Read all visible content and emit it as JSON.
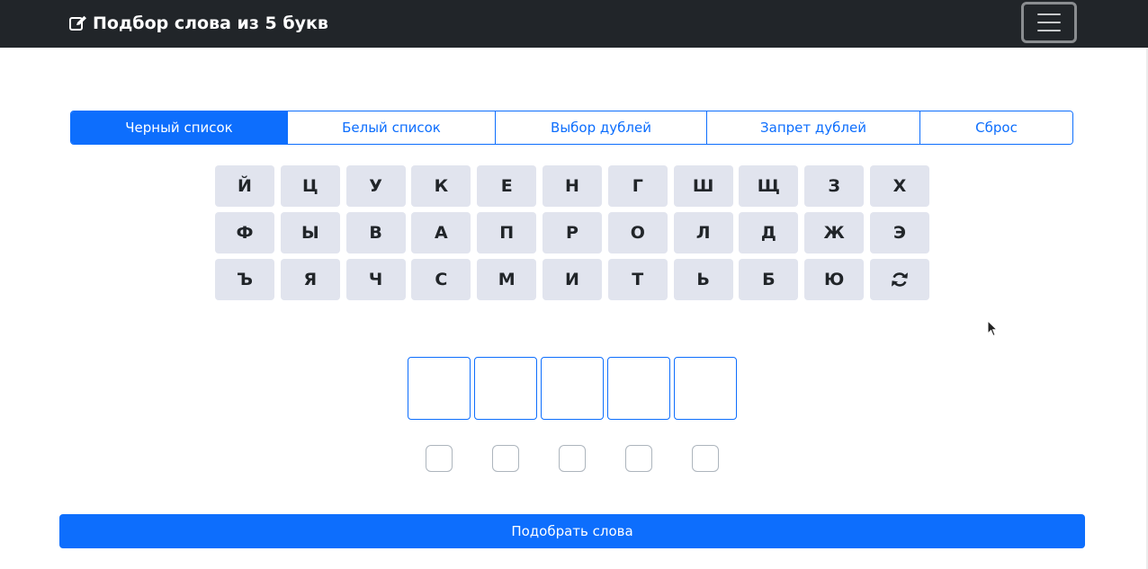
{
  "navbar": {
    "title": "Подбор слова из 5 букв",
    "title_icon": "edit-icon",
    "menu_icon": "hamburger-icon"
  },
  "tabs": [
    {
      "label": "Черный список",
      "active": true
    },
    {
      "label": "Белый список",
      "active": false
    },
    {
      "label": "Выбор дублей",
      "active": false
    },
    {
      "label": "Запрет дублей",
      "active": false
    },
    {
      "label": "Сброс",
      "active": false
    }
  ],
  "keyboard": {
    "rows": [
      [
        "Й",
        "Ц",
        "У",
        "К",
        "Е",
        "Н",
        "Г",
        "Ш",
        "Щ",
        "З",
        "Х"
      ],
      [
        "Ф",
        "Ы",
        "В",
        "А",
        "П",
        "Р",
        "О",
        "Л",
        "Д",
        "Ж",
        "Э"
      ],
      [
        "Ъ",
        "Я",
        "Ч",
        "С",
        "М",
        "И",
        "Т",
        "Ь",
        "Б",
        "Ю"
      ]
    ],
    "refresh_icon": "refresh-icon"
  },
  "letters": [
    "",
    "",
    "",
    "",
    ""
  ],
  "checkboxes": [
    false,
    false,
    false,
    false,
    false
  ],
  "submit_label": "Подобрать слова",
  "colors": {
    "navbar": "#212529",
    "primary": "#0d6efd",
    "key_bg": "#e1e4ee"
  }
}
